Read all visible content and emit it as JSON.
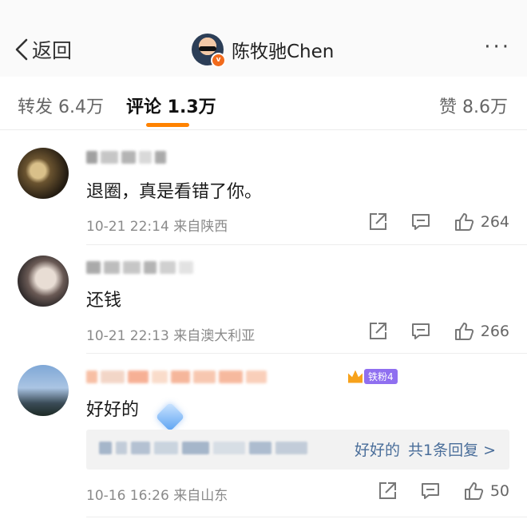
{
  "header": {
    "back_label": "返回",
    "user_name": "陈牧驰Chen",
    "more_label": "···"
  },
  "tabs": {
    "forward": "转发 6.4万",
    "comment": "评论 1.3万",
    "like": "赞 8.6万"
  },
  "colors": {
    "accent": "#ff8200",
    "link": "#4a6e9a"
  },
  "comments": [
    {
      "text": "退圈，真是看错了你。",
      "meta": "10-21 22:14  来自陕西",
      "likes": "264"
    },
    {
      "text": "还钱",
      "meta": "10-21 22:13  来自澳大利亚",
      "likes": "266"
    },
    {
      "text": "好好的",
      "meta": "10-16 16:26  来自山东",
      "likes": "50",
      "fan_badge": "铁粉4",
      "reply_summary": "好好的",
      "reply_count": "共1条回复 >"
    }
  ]
}
